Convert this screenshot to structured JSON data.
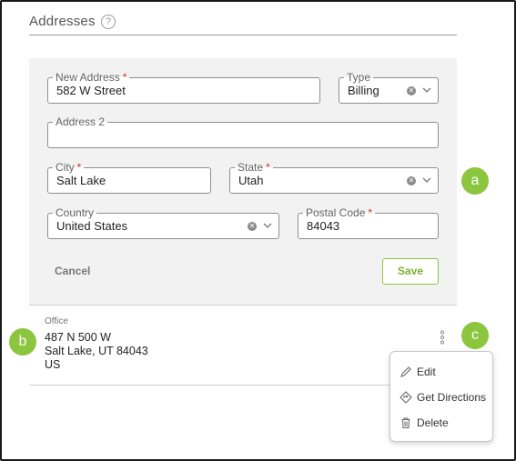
{
  "section": {
    "title": "Addresses"
  },
  "form": {
    "new_address": {
      "label": "New Address",
      "value": "582 W Street",
      "required": true
    },
    "type": {
      "label": "Type",
      "value": "Billing"
    },
    "address2": {
      "label": "Address 2",
      "value": ""
    },
    "city": {
      "label": "City",
      "value": "Salt Lake",
      "required": true
    },
    "state": {
      "label": "State",
      "value": "Utah",
      "required": true
    },
    "country": {
      "label": "Country",
      "value": "United States"
    },
    "postal_code": {
      "label": "Postal Code",
      "value": "84043",
      "required": true
    },
    "cancel_label": "Cancel",
    "save_label": "Save"
  },
  "saved_address": {
    "type": "Office",
    "line1": "487 N 500 W",
    "line2": "Salt Lake, UT 84043",
    "line3": "US"
  },
  "context_menu": {
    "items": [
      {
        "label": "Edit",
        "icon": "pencil-icon"
      },
      {
        "label": "Get Directions",
        "icon": "directions-icon"
      },
      {
        "label": "Delete",
        "icon": "trash-icon"
      }
    ]
  },
  "callouts": {
    "a": "a",
    "b": "b",
    "c": "c"
  },
  "colors": {
    "accent": "#8cc63f",
    "required": "#d33333",
    "panel_bg": "#f2f2f2"
  }
}
